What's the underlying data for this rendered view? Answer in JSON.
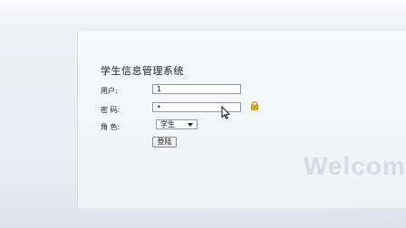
{
  "page": {
    "title": "学生信息管理系统",
    "watermark": "Welcom"
  },
  "form": {
    "username": {
      "label": "用户:",
      "value": "1"
    },
    "password": {
      "label": "密 码:",
      "value": "•"
    },
    "role": {
      "label": "角 色:",
      "selected": "学生"
    },
    "submit_label": "登陆"
  },
  "icons": {
    "lock": "lock-icon",
    "cursor": "mouse-cursor-icon",
    "dropdown": "chevron-down-icon"
  },
  "colors": {
    "background": "#e9edf2",
    "panel": "#f6f8fa",
    "input_border": "#8e9aa8",
    "text": "#222222",
    "watermark": "#d5dce5",
    "lock": "#e0b21d"
  }
}
